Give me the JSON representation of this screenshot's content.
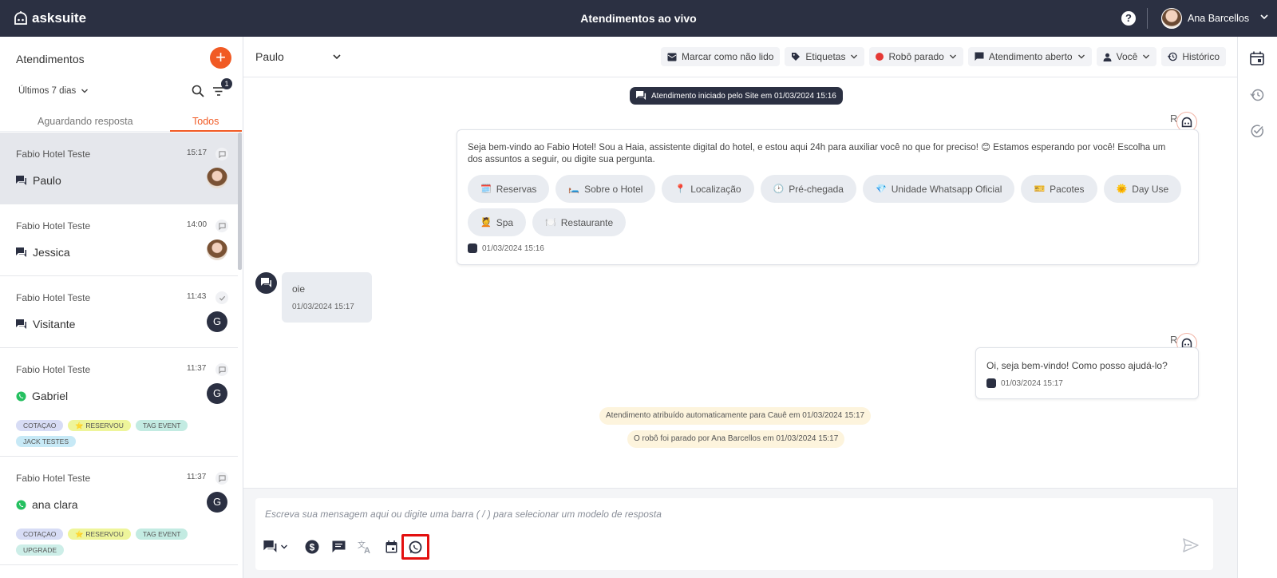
{
  "header": {
    "brand": "asksuite",
    "title": "Atendimentos ao vivo",
    "help": "?",
    "user_name": "Ana Barcellos"
  },
  "sidebar": {
    "title": "Atendimentos",
    "add_label": "+",
    "period": "Últimos 7 dias",
    "filter_count": "1",
    "tabs": [
      "Aguardando resposta",
      "Todos"
    ],
    "conversations": [
      {
        "hotel": "Fabio Hotel Teste",
        "time": "15:17",
        "name": "Paulo",
        "channel": "chat",
        "avatar": "photo",
        "tags": []
      },
      {
        "hotel": "Fabio Hotel Teste",
        "time": "14:00",
        "name": "Jessica",
        "channel": "chat",
        "avatar": "photo",
        "tags": []
      },
      {
        "hotel": "Fabio Hotel Teste",
        "time": "11:43",
        "name": "Visitante",
        "channel": "chat",
        "avatar": "G",
        "tags": []
      },
      {
        "hotel": "Fabio Hotel Teste",
        "time": "11:37",
        "name": "Gabriel",
        "channel": "whatsapp",
        "avatar": "G",
        "tags": [
          "COTAÇAO",
          "⭐ RESERVOU",
          "TAG EVENT",
          "JACK TESTES"
        ]
      },
      {
        "hotel": "Fabio Hotel Teste",
        "time": "11:37",
        "name": "ana clara",
        "channel": "whatsapp",
        "avatar": "G",
        "tags": [
          "COTAÇAO",
          "⭐ RESERVOU",
          "TAG EVENT",
          "UPGRADE"
        ]
      }
    ]
  },
  "chat": {
    "contact": "Paulo",
    "actions": {
      "mark_unread": "Marcar como não lido",
      "tags": "Etiquetas",
      "robot": "Robô parado",
      "status": "Atendimento aberto",
      "assignee": "Você",
      "history": "Histórico"
    },
    "started_notice": "Atendimento iniciado pelo Site em 01/03/2024 15:16",
    "robot_label": "Robô",
    "bot_message": {
      "text": "Seja bem-vindo ao Fabio Hotel! Sou a Haia, assistente digital do hotel, e estou aqui 24h para auxiliar você no que for preciso! 😊 Estamos esperando por você! Escolha um dos assuntos a seguir, ou digite sua pergunta.",
      "quick_replies": [
        {
          "icon": "🗓️",
          "label": "Reservas"
        },
        {
          "icon": "🛏️",
          "label": "Sobre o Hotel"
        },
        {
          "icon": "📍",
          "label": "Localização"
        },
        {
          "icon": "🕑",
          "label": "Pré-chegada"
        },
        {
          "icon": "💎",
          "label": "Unidade Whatsapp Oficial"
        },
        {
          "icon": "🎫",
          "label": "Pacotes"
        },
        {
          "icon": "🌞",
          "label": "Day Use"
        },
        {
          "icon": "💆",
          "label": "Spa"
        },
        {
          "icon": "🍽️",
          "label": "Restaurante"
        }
      ],
      "time": "01/03/2024 15:16"
    },
    "user_message": {
      "text": "oie",
      "time": "01/03/2024 15:17"
    },
    "bot_reply": {
      "text": "Oi, seja bem-vindo! Como posso ajudá-lo?",
      "time": "01/03/2024 15:17"
    },
    "system_notices": [
      "Atendimento atribuído automaticamente para Cauê em 01/03/2024 15:17",
      "O robô foi parado por Ana Barcellos em 01/03/2024 15:17"
    ],
    "composer_placeholder": "Escreva sua mensagem aqui ou digite uma barra ( / ) para selecionar um modelo de resposta"
  },
  "colors": {
    "topbar": "#2b3042",
    "accent": "#f15a24",
    "highlight_border": "#e3100f",
    "robot_stopped": "#e53935"
  }
}
